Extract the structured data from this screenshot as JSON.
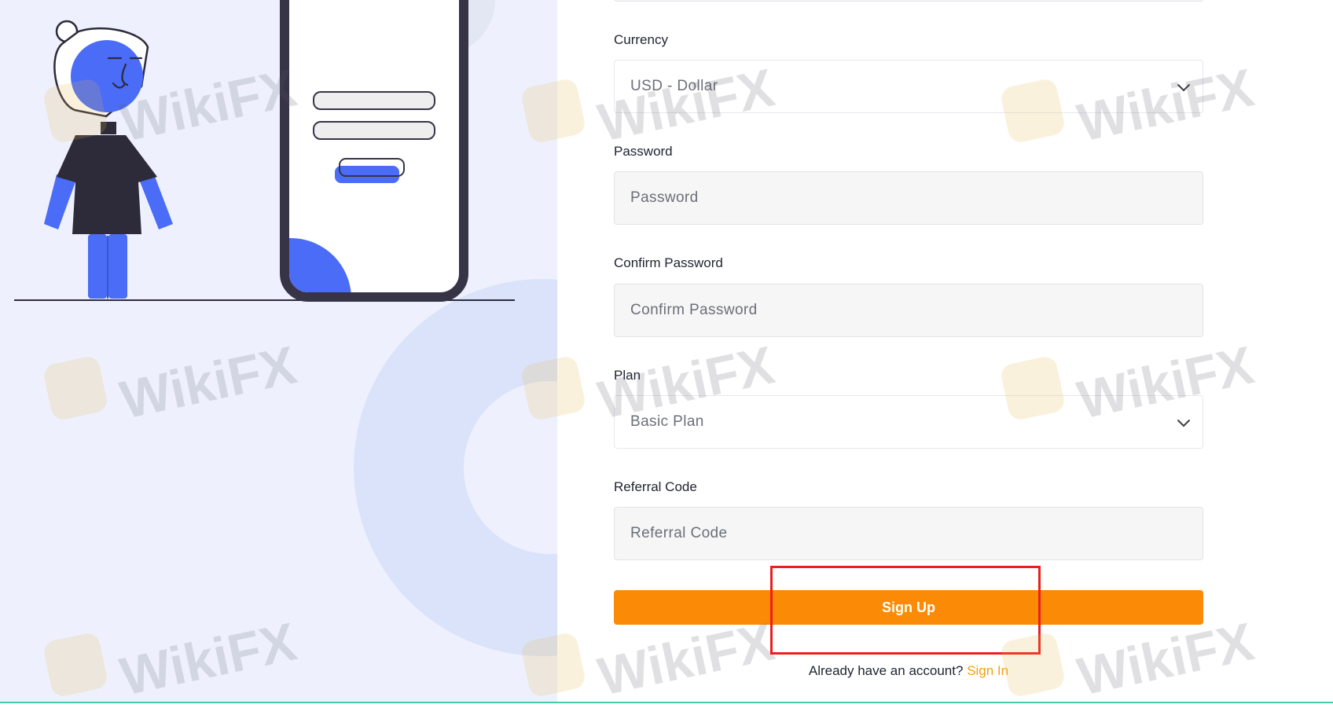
{
  "form": {
    "currency": {
      "label": "Currency",
      "value": "USD - Dollar"
    },
    "password": {
      "label": "Password",
      "placeholder": "Password"
    },
    "confirm_password": {
      "label": "Confirm Password",
      "placeholder": "Confirm Password"
    },
    "plan": {
      "label": "Plan",
      "value": "Basic Plan"
    },
    "referral_code": {
      "label": "Referral Code",
      "placeholder": "Referral Code"
    },
    "submit_label": "Sign Up",
    "signin_prompt": "Already have an account?",
    "signin_link": "Sign In"
  },
  "watermark": {
    "text": "WikiFX"
  },
  "colors": {
    "accent": "#fb8b06",
    "link": "#f59f10",
    "highlight": "#e9201e",
    "illustration_blue": "#4a6cf7",
    "left_bg": "#eef1fd"
  },
  "icons": [
    "chevron-down-icon",
    "person-illustration",
    "phone-illustration"
  ]
}
